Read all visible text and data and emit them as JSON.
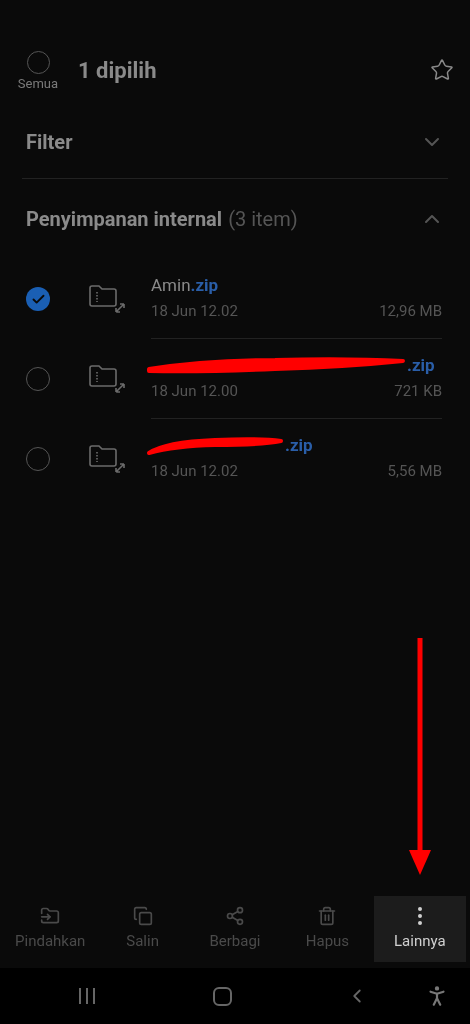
{
  "header": {
    "select_all_label": "Semua",
    "select_all_checked": false,
    "title": "1 dipilih"
  },
  "filter": {
    "label": "Filter",
    "expanded": false
  },
  "section": {
    "title": "Penyimpanan internal",
    "count": "(3 item)",
    "expanded": true
  },
  "files": [
    {
      "name": "Amin",
      "ext": ".zip",
      "date": "18 Jun 12.02",
      "size": "12,96 MB",
      "checked": true,
      "scribbled": false
    },
    {
      "ext": ".zip",
      "date": "18 Jun 12.00",
      "size": "721 KB",
      "checked": false,
      "scribbled": true
    },
    {
      "ext": ".zip",
      "date": "18 Jun 12.02",
      "size": "5,56 MB",
      "checked": false,
      "scribbled": true
    }
  ],
  "actions": [
    {
      "kind": "move",
      "label": "Pindahkan",
      "selected": false
    },
    {
      "kind": "copy",
      "label": "Salin",
      "selected": false
    },
    {
      "kind": "share",
      "label": "Berbagi",
      "selected": false
    },
    {
      "kind": "delete",
      "label": "Hapus",
      "selected": false
    },
    {
      "kind": "more",
      "label": "Lainnya",
      "selected": true
    }
  ],
  "annotation_arrow": true
}
